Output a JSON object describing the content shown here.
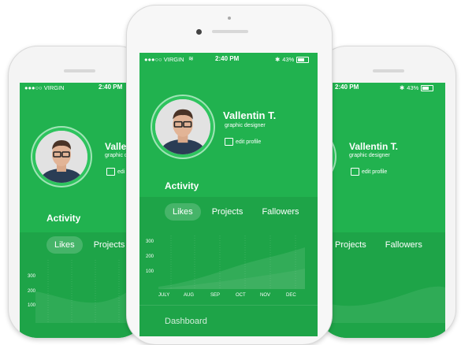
{
  "status": {
    "carrier": "●●●○○ VIRGIN",
    "time": "2:40 PM",
    "battery": "43%"
  },
  "profile": {
    "name": "Vallentin T.",
    "role": "graphic designer",
    "edit_label": "edit profile",
    "name_clipped": "Vallen",
    "role_clipped": "graphic de",
    "edit_clipped": "edi"
  },
  "activity_title": "Activity",
  "tabs": [
    "Likes",
    "Projects",
    "Fallowers"
  ],
  "chart": {
    "y_ticks": [
      "300",
      "200",
      "100"
    ],
    "x_ticks": [
      "JULY",
      "AUG",
      "SEP",
      "OCT",
      "NOV",
      "DEC"
    ]
  },
  "dashboard_label": "Dashboard",
  "colors": {
    "primary": "#21b24f",
    "secondary": "#1ea448"
  }
}
